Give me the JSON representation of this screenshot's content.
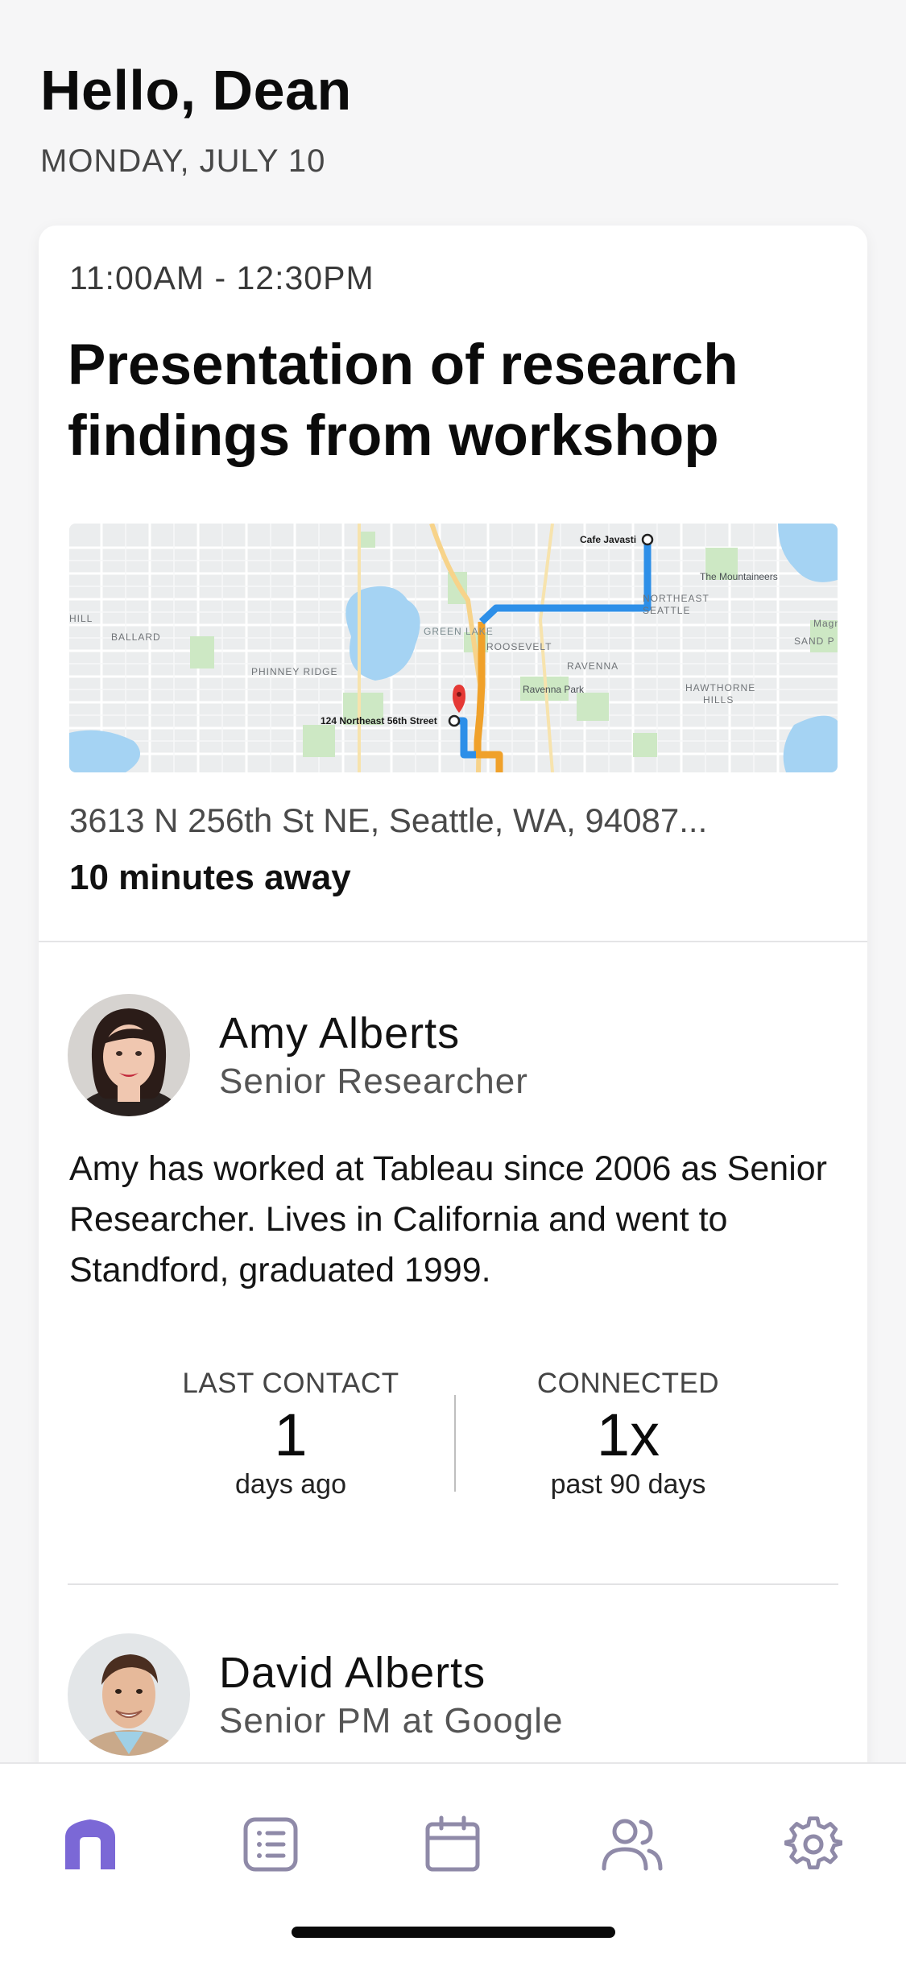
{
  "header": {
    "greeting": "Hello, Dean",
    "date": "MONDAY, JULY 10"
  },
  "event": {
    "time": "11:00AM - 12:30PM",
    "title": "Presentation of research findings from workshop",
    "address": "3613 N 256th St NE, Seattle, WA, 94087...",
    "travel_time": "10 minutes away",
    "map": {
      "origin_label": "124 Northeast 56th Street",
      "destination_label": "Cafe Javasti",
      "place_labels": [
        "BALLARD",
        "PHINNEY RIDGE",
        "GREEN LAKE",
        "ROOSEVELT",
        "RAVENNA",
        "NORTHEAST SEATTLE",
        "HAWTHORNE HILLS",
        "Ravenna Park",
        "The Mountaineers",
        "HILL",
        "Magn",
        "SAND P"
      ]
    }
  },
  "contacts": [
    {
      "name": "Amy Alberts",
      "role": "Senior Researcher",
      "bio": "Amy has worked at Tableau since 2006 as Senior Researcher. Lives in California and went to Standford, graduated 1999.",
      "stats": {
        "last_contact_label": "LAST CONTACT",
        "last_contact_value": "1",
        "last_contact_sub": "days ago",
        "connected_label": "CONNECTED",
        "connected_value": "1x",
        "connected_sub": "past 90 days"
      }
    },
    {
      "name": "David Alberts",
      "role": "Senior PM at Google"
    }
  ],
  "tabbar": {
    "active_color": "#7b68d6",
    "inactive_color": "#8f8aa8",
    "items": [
      "home-icon",
      "list-icon",
      "calendar-icon",
      "people-icon",
      "gear-icon"
    ]
  }
}
